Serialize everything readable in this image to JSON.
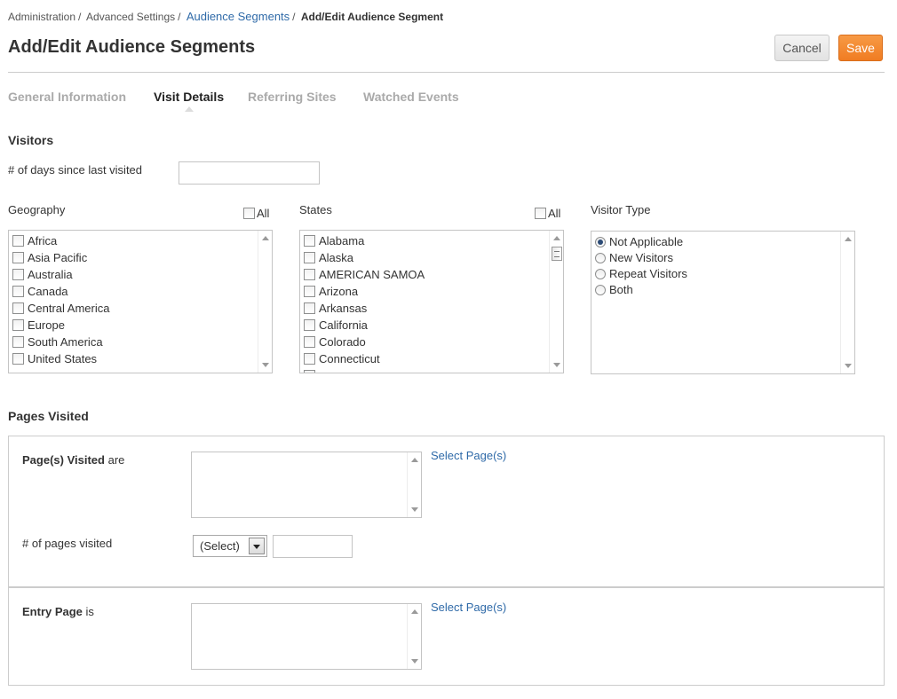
{
  "breadcrumb": {
    "items": [
      "Administration",
      "Advanced Settings",
      "Audience Segments"
    ],
    "current": "Add/Edit Audience Segment",
    "separator": "/"
  },
  "header": {
    "title": "Add/Edit Audience Segments",
    "cancel_label": "Cancel",
    "save_label": "Save"
  },
  "tabs": [
    {
      "label": "General Information",
      "active": false
    },
    {
      "label": "Visit Details",
      "active": true
    },
    {
      "label": "Referring Sites",
      "active": false
    },
    {
      "label": "Watched Events",
      "active": false
    }
  ],
  "visitors": {
    "title": "Visitors",
    "days_label": "# of days since last visited",
    "days_value": "",
    "geography": {
      "label": "Geography",
      "all_label": "All",
      "items": [
        "Africa",
        "Asia Pacific",
        "Australia",
        "Canada",
        "Central America",
        "Europe",
        "South America",
        "United States"
      ]
    },
    "states": {
      "label": "States",
      "all_label": "All",
      "items": [
        "Alabama",
        "Alaska",
        "AMERICAN SAMOA",
        "Arizona",
        "Arkansas",
        "California",
        "Colorado",
        "Connecticut"
      ]
    },
    "visitor_type": {
      "label": "Visitor Type",
      "options": [
        "Not Applicable",
        "New Visitors",
        "Repeat Visitors",
        "Both"
      ],
      "selected": "Not Applicable"
    }
  },
  "pages_visited": {
    "title": "Pages Visited",
    "pages_label_bold": "Page(s) Visited",
    "pages_label_rest": "are",
    "select_pages_link": "Select Page(s)",
    "num_pages_label": "# of pages visited",
    "num_pages_select": "(Select)",
    "num_pages_value": "",
    "entry_label_bold": "Entry Page",
    "entry_label_rest": "is",
    "entry_select_link": "Select Page(s)"
  },
  "colors": {
    "link": "#2f6aa8",
    "save_button": "#f0812a",
    "radio_selected": "#2b4a75"
  }
}
